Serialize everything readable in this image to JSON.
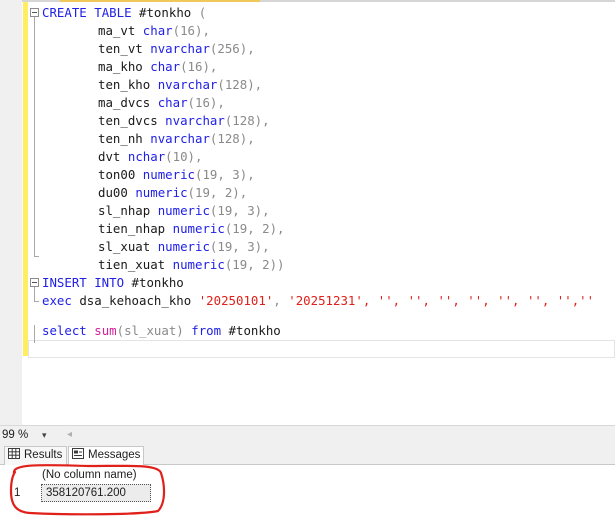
{
  "editor": {
    "lines": {
      "l1": {
        "kw1": "CREATE",
        "kw2": "TABLE",
        "name": "#tonkho",
        "paren": "("
      },
      "l2": {
        "col": "ma_vt",
        "type": "char",
        "args": "(16),"
      },
      "l3": {
        "col": "ten_vt",
        "type": "nvarchar",
        "args": "(256),"
      },
      "l4": {
        "col": "ma_kho",
        "type": "char",
        "args": "(16),"
      },
      "l5": {
        "col": "ten_kho",
        "type": "nvarchar",
        "args": "(128),"
      },
      "l6": {
        "col": "ma_dvcs",
        "type": "char",
        "args": "(16),"
      },
      "l7": {
        "col": "ten_dvcs",
        "type": "nvarchar",
        "args": "(128),"
      },
      "l8": {
        "col": "ten_nh",
        "type": "nvarchar",
        "args": "(128),"
      },
      "l9": {
        "col": "dvt",
        "type": "nchar",
        "args": "(10),"
      },
      "l10": {
        "col": "ton00",
        "type": "numeric",
        "args": "(19, 3),"
      },
      "l11": {
        "col": "du00",
        "type": "numeric",
        "args": "(19, 2),"
      },
      "l12": {
        "col": "sl_nhap",
        "type": "numeric",
        "args": "(19, 3),"
      },
      "l13": {
        "col": "tien_nhap",
        "type": "numeric",
        "args": "(19, 2),"
      },
      "l14": {
        "col": "sl_xuat",
        "type": "numeric",
        "args": "(19, 3),"
      },
      "l15": {
        "col": "tien_xuat",
        "type": "numeric",
        "args": "(19, 2))"
      },
      "l17": {
        "kw": "INSERT INTO",
        "target": "#tonkho"
      },
      "l18": {
        "kw": "exec",
        "proc": "dsa_kehoach_kho",
        "arg1": "'20250101'",
        "comma": ",",
        "arg2": "'20251231'",
        "rest": ", '', '', '', '', '', '', '',''"
      },
      "l20": {
        "kw1": "select",
        "fn": "sum",
        "arg": "(sl_xuat)",
        "kw2": "from",
        "table": "#tonkho"
      }
    }
  },
  "status": {
    "zoom": "99 %",
    "dropdown_glyph": "▾",
    "scroll_left_glyph": "◂"
  },
  "results": {
    "tabs": {
      "results_label": "Results",
      "messages_label": "Messages"
    },
    "grid": {
      "column_header": "(No column name)",
      "row_number": "1",
      "value": "358120761.200"
    }
  },
  "colors": {
    "keyword": "#2020e8",
    "function": "#d2209a",
    "string": "#e0201a",
    "change_bar": "#ffee62",
    "annotation": "#e0201a"
  }
}
